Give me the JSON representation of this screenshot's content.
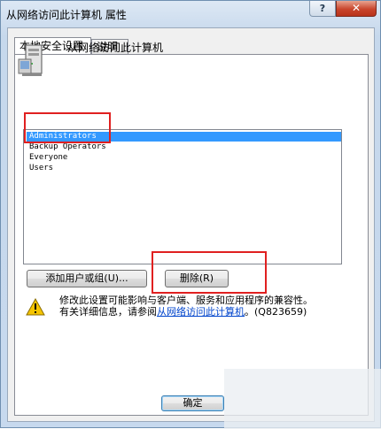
{
  "window": {
    "title": "从网络访问此计算机 属性",
    "help_label": "?",
    "close_label": "✕"
  },
  "tabs": [
    {
      "label": "本地安全设置",
      "active": true
    },
    {
      "label": "说明",
      "active": false
    }
  ],
  "policy": {
    "icon": "computer-tower-icon",
    "title": "从网络访问此计算机"
  },
  "list": {
    "items": [
      "Administrators",
      "Backup Operators",
      "Everyone",
      "Users"
    ],
    "selected_index": 0
  },
  "buttons": {
    "add_label": "添加用户或组(U)...",
    "remove_label": "删除(R)",
    "ok_label": "确定"
  },
  "warning": {
    "icon": "warning-icon",
    "line1": "修改此设置可能影响与客户端、服务和应用程序的兼容性。",
    "line2_prefix": "有关详细信息，请参阅",
    "link": "从网络访问此计算机",
    "line2_suffix": "。(Q823659)"
  },
  "colors": {
    "selection": "#3399ff",
    "annotation": "#e02020",
    "link": "#0044cc"
  }
}
